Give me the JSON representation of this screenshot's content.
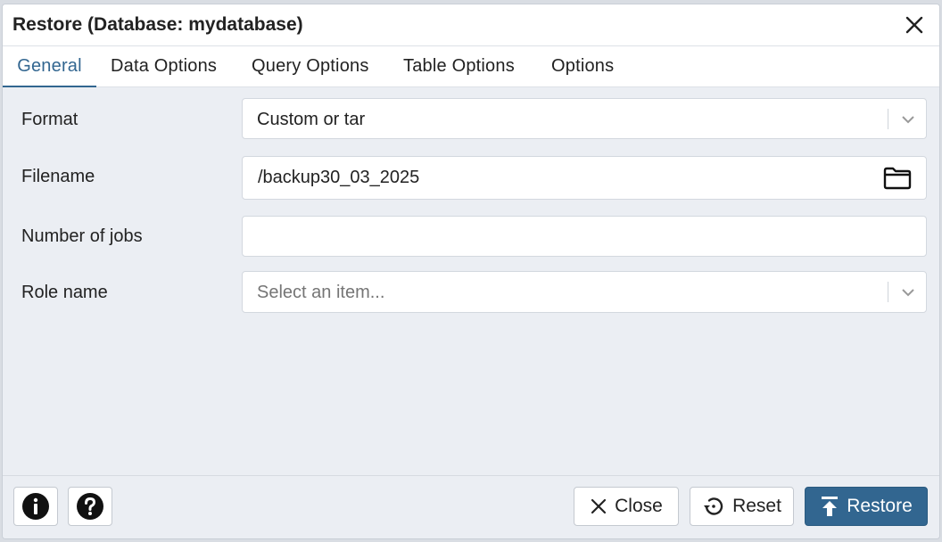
{
  "dialog": {
    "title": "Restore (Database: mydatabase)"
  },
  "tabs": [
    {
      "label": "General",
      "active": true
    },
    {
      "label": "Data Options",
      "active": false
    },
    {
      "label": "Query Options",
      "active": false
    },
    {
      "label": "Table Options",
      "active": false
    },
    {
      "label": "Options",
      "active": false
    }
  ],
  "form": {
    "format": {
      "label": "Format",
      "value": "Custom or tar"
    },
    "filename": {
      "label": "Filename",
      "value": "/backup30_03_2025"
    },
    "jobs": {
      "label": "Number of jobs",
      "value": ""
    },
    "role": {
      "label": "Role name",
      "placeholder": "Select an item..."
    }
  },
  "footer": {
    "info_icon": "info-icon",
    "help_icon": "help-icon",
    "close_label": "Close",
    "reset_label": "Reset",
    "restore_label": "Restore"
  },
  "colors": {
    "accent": "#326690",
    "background": "#ebeef3"
  }
}
